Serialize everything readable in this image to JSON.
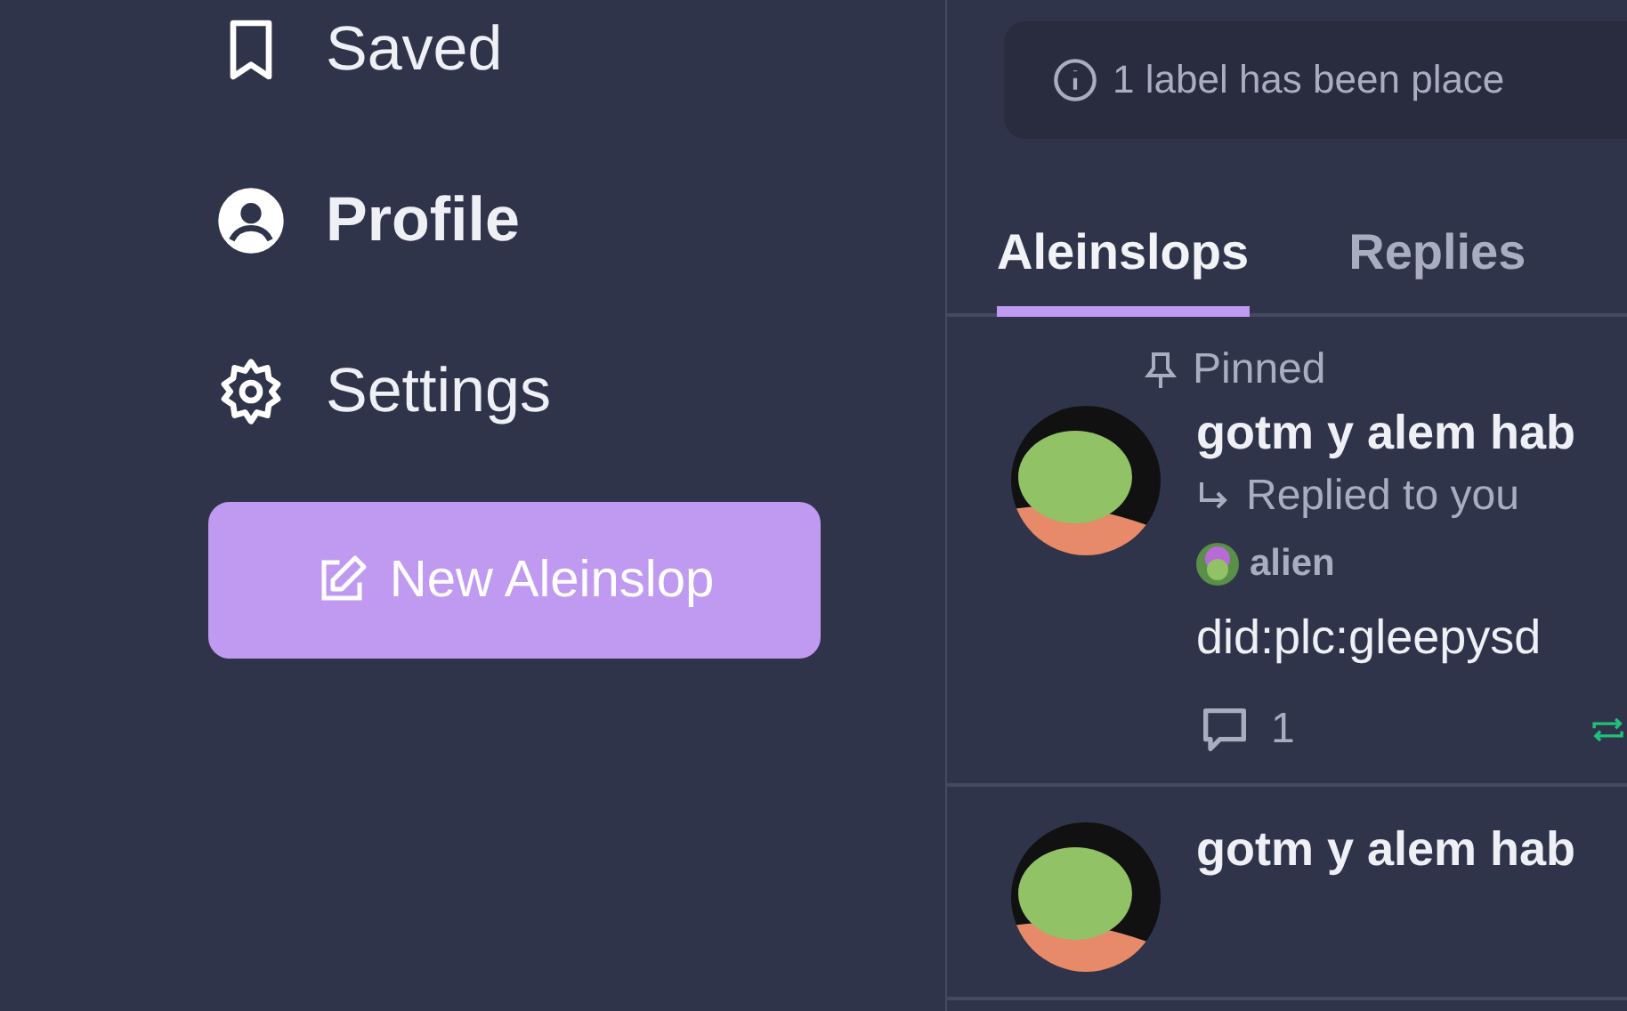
{
  "sidebar": {
    "items": [
      {
        "kind": "bookmark",
        "label": "Saved",
        "selected": false
      },
      {
        "kind": "profile",
        "label": "Profile",
        "selected": true
      },
      {
        "kind": "gear",
        "label": "Settings",
        "selected": false
      }
    ],
    "compose_button": "New Aleinslop"
  },
  "banner": {
    "text": "1 label has been place"
  },
  "tabs": [
    {
      "label": "Aleinslops",
      "selected": true
    },
    {
      "label": "Replies",
      "selected": false
    }
  ],
  "posts": [
    {
      "pinned_label": "Pinned",
      "author": "gotm y alem hab",
      "reply_note": "Replied to you",
      "label_author": "alien",
      "text": "did:plc:gleepysd",
      "reply_count": "1",
      "reposted": true
    },
    {
      "author": "gotm y alem hab"
    }
  ]
}
